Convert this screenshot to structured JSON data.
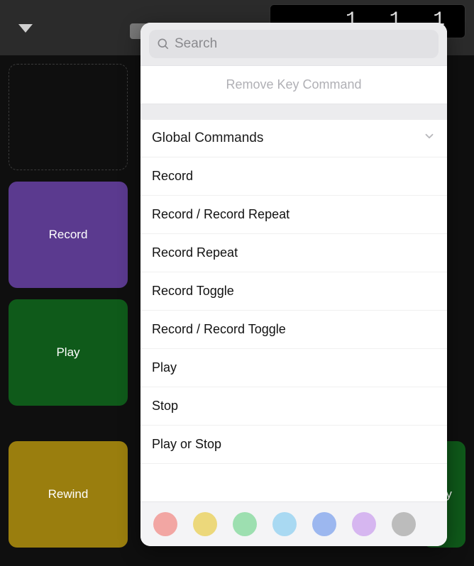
{
  "timecode": "1 1 1",
  "tiles": {
    "record": "Record",
    "play": "Play",
    "rewind": "Rewind",
    "play2": "lay"
  },
  "popover": {
    "search_placeholder": "Search",
    "remove_label": "Remove Key Command",
    "section_title": "Global Commands",
    "commands": [
      "Record",
      "Record / Record Repeat",
      "Record Repeat",
      "Record Toggle",
      "Record / Record Toggle",
      "Play",
      "Stop",
      "Play or Stop"
    ],
    "colors": [
      "#f2a6a3",
      "#ecd87b",
      "#9ddfb0",
      "#a9d9f2",
      "#9cb7ef",
      "#d6b6f0",
      "#bcbcbc"
    ]
  }
}
